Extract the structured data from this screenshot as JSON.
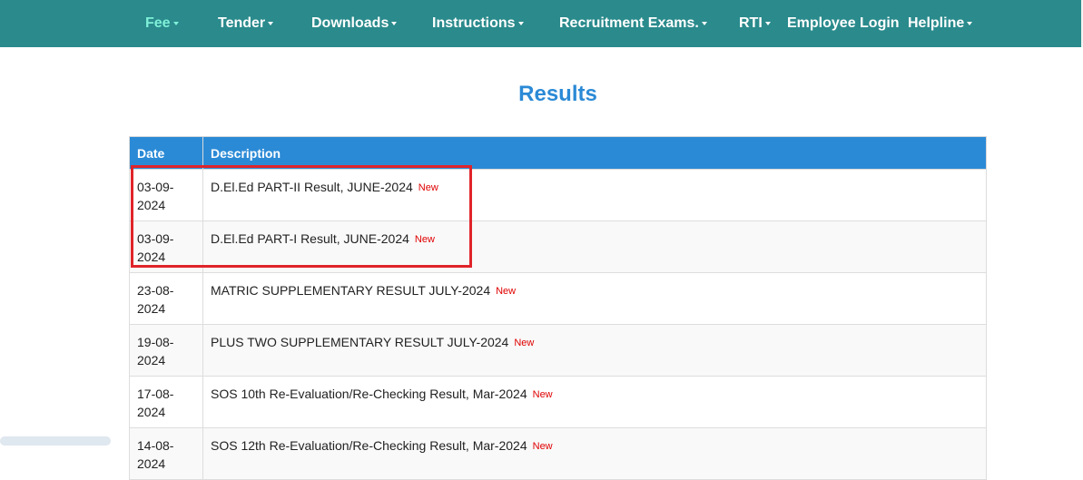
{
  "nav": {
    "items": [
      {
        "label": "Fee",
        "dropdown": true,
        "active": true
      },
      {
        "label": "Tender",
        "dropdown": true,
        "active": false
      },
      {
        "label": "Downloads",
        "dropdown": true,
        "active": false
      },
      {
        "label": "Instructions",
        "dropdown": true,
        "active": false
      },
      {
        "label": "Recruitment Exams.",
        "dropdown": true,
        "active": false
      },
      {
        "label": "RTI",
        "dropdown": true,
        "active": false
      },
      {
        "label": "Employee Login",
        "dropdown": false,
        "active": false
      },
      {
        "label": "Helpline",
        "dropdown": true,
        "active": false
      }
    ]
  },
  "page": {
    "title": "Results"
  },
  "table": {
    "columns": [
      "Date",
      "Description"
    ],
    "badge": "New",
    "rows": [
      {
        "date": "03-09-2024",
        "description": "D.El.Ed PART-II Result, JUNE-2024",
        "new": true
      },
      {
        "date": "03-09-2024",
        "description": "D.El.Ed PART-I Result, JUNE-2024",
        "new": true
      },
      {
        "date": "23-08-2024",
        "description": "MATRIC SUPPLEMENTARY RESULT JULY-2024",
        "new": true
      },
      {
        "date": "19-08-2024",
        "description": "PLUS TWO SUPPLEMENTARY RESULT JULY-2024",
        "new": true
      },
      {
        "date": "17-08-2024",
        "description": "SOS 10th Re-Evaluation/Re-Checking Result, Mar-2024",
        "new": true
      },
      {
        "date": "14-08-2024",
        "description": "SOS 12th Re-Evaluation/Re-Checking Result, Mar-2024",
        "new": true
      }
    ]
  },
  "colors": {
    "navbar": "#2a8a8c",
    "nav_active": "#7ff0d8",
    "title": "#2b8ad6",
    "table_header": "#2b8ad6",
    "badge_new": "#e00000",
    "highlight_box": "#e0242a"
  }
}
